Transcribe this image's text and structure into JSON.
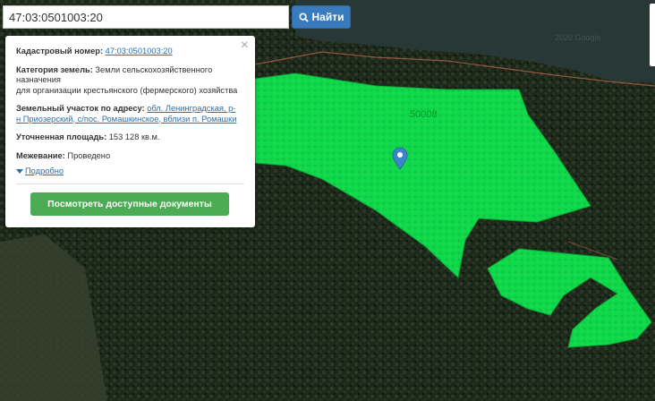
{
  "search": {
    "value": "47:03:0501003:20",
    "button_label": "Найти"
  },
  "popup": {
    "cadastral_label": "Кадастровый номер:",
    "cadastral_value": "47:03:0501003:20",
    "category_label": "Категория земель:",
    "category_value_1": "Земли сельскохозяйственного",
    "category_value_2": "назначения",
    "category_value_3": "для организации крестьянского (фермерского) хозяйства",
    "address_label": "Земельный участок по адресу:",
    "address_value_1": "обл. Ленинградская, р-",
    "address_value_2": "н Приозерский, с/пос. Ромашкинское, вблизи п. Ромашки",
    "area_label": "Уточненная площадь:",
    "area_value": "153 128 кв.м.",
    "survey_label": "Межевание:",
    "survey_value": "Проведено",
    "more_label": "Подробно",
    "docs_button": "Посмотреть доступные документы"
  },
  "map": {
    "parcel_label": "50008",
    "watermark": "2020 Google",
    "colors": {
      "parcel": "#10d84a",
      "forest": "#1f2a1c",
      "water": "#2b3b3a"
    }
  }
}
